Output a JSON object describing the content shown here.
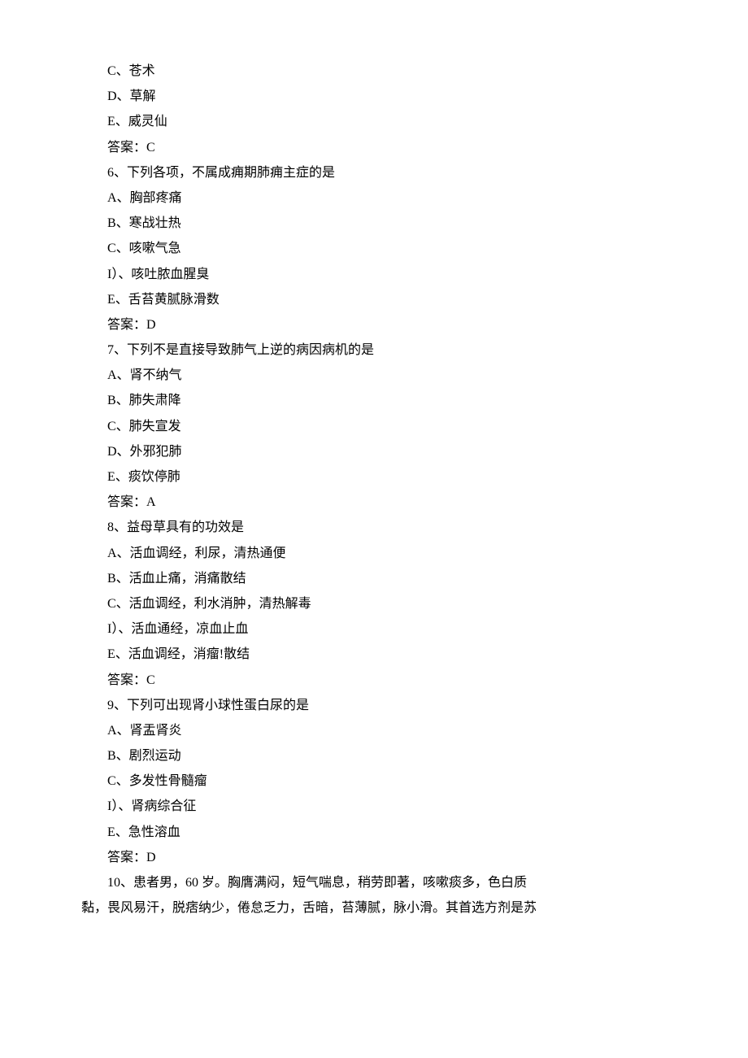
{
  "lines": [
    "C、苍术",
    "D、草解",
    "E、威灵仙",
    "答案：C",
    "6、下列各项，不属成痈期肺痈主症的是",
    "A、胸部疼痛",
    "B、寒战壮热",
    "C、咳嗽气急",
    "I）、咳吐脓血腥臭",
    "E、舌苔黄腻脉滑数",
    "答案：D",
    "7、下列不是直接导致肺气上逆的病因病机的是",
    "A、肾不纳气",
    "B、肺失肃降",
    "C、肺失宣发",
    "D、外邪犯肺",
    "E、痰饮停肺",
    "答案：A",
    "8、益母草具有的功效是",
    "A、活血调经，利尿，清热通便",
    "B、活血止痛，消痛散结",
    "C、活血调经，利水消肿，清热解毒",
    "I）、活血通经，凉血止血",
    "E、活血调经，消瘤!散结",
    "答案：C",
    "9、下列可出现肾小球性蛋白尿的是",
    "A、肾盂肾炎",
    "B、剧烈运动",
    "C、多发性骨髓瘤",
    "I）、肾病综合征",
    "E、急性溶血",
    "答案：D",
    "10、患者男，60 岁。胸膺满闷，短气喘息，稍劳即著，咳嗽痰多，色白质"
  ],
  "wrap_line": "黏，畏风易汗，脱痞纳少，倦怠乏力，舌暗，苔薄腻，脉小滑。其首选方剂是苏"
}
